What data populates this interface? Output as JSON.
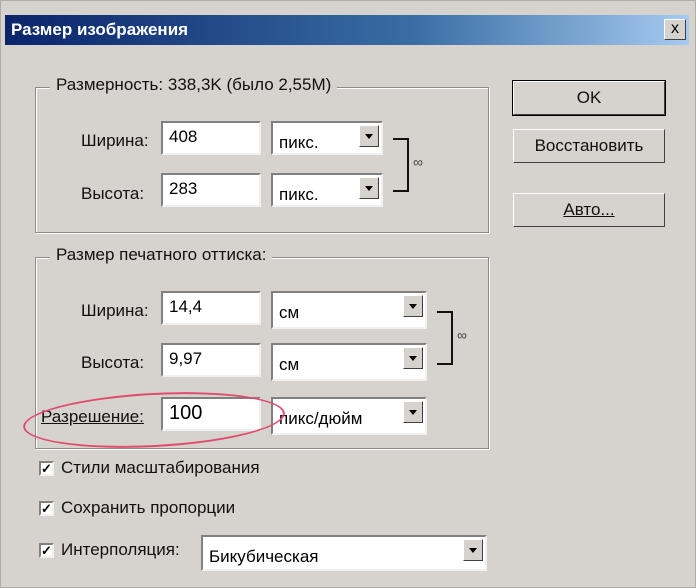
{
  "window": {
    "title": "Размер изображения",
    "close": "x"
  },
  "pixel_dimensions": {
    "legend": "Размерность:  338,3K (было 2,55M)",
    "width_label": "Ширина:",
    "width_value": "408",
    "width_unit": "пикс.",
    "height_label": "Высота:",
    "height_value": "283",
    "height_unit": "пикс."
  },
  "document_size": {
    "legend": "Размер печатного оттиска:",
    "width_label": "Ширина:",
    "width_value": "14,4",
    "width_unit": "см",
    "height_label": "Высота:",
    "height_value": "9,97",
    "height_unit": "см",
    "resolution_label": "Разрешение:",
    "resolution_value": "100",
    "resolution_unit": "пикс/дюйм"
  },
  "buttons": {
    "ok": "OK",
    "reset": "Восстановить",
    "auto": "Авто..."
  },
  "options": {
    "scale_styles": "Стили масштабирования",
    "constrain": "Сохранить пропорции",
    "resample": "Интерполяция:",
    "resample_method": "Бикубическая"
  },
  "colors": {
    "highlight_ellipse": "#e14b6e"
  }
}
